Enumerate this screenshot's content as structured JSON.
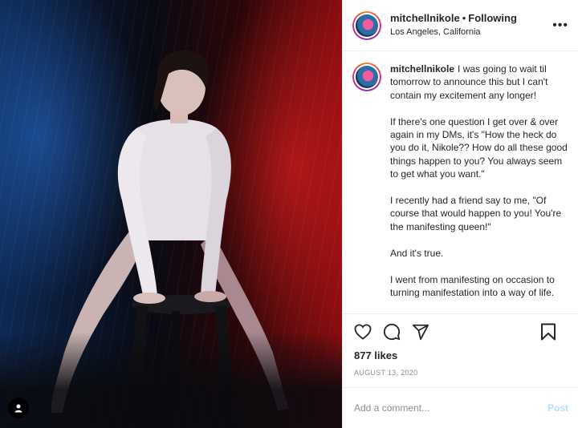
{
  "post": {
    "user": {
      "username": "mitchellnikole",
      "follow_status": "Following",
      "separator": "•",
      "location": "Los Angeles, California"
    },
    "caption_text": "I was going to wait til tomorrow to announce this but I can't contain my excitement any longer!\n\nIf there's one question I get over & over again in my DMs, it's \"How the heck do you do it, Nikole?? How do all these good things happen to you? You always seem to get what you want.\"\n\nI recently had a friend say to me, \"Of course that would happen to you! You're the manifesting queen!\"\n\nAnd it's true.\n\nI went from manifesting on occasion to turning manifestation into a way of life.",
    "likes": "877 likes",
    "date": "AUGUST 13, 2020",
    "comment_placeholder": "Add a comment...",
    "post_label": "Post",
    "more_label": "•••"
  },
  "icons": {
    "like": "heart-icon",
    "comment": "comment-icon",
    "share": "share-icon",
    "save": "bookmark-icon",
    "tags": "user-tag-icon"
  },
  "colors": {
    "text": "#262626",
    "muted": "#8e8e8e",
    "border": "#efefef",
    "post_disabled": "#b2dffc"
  }
}
